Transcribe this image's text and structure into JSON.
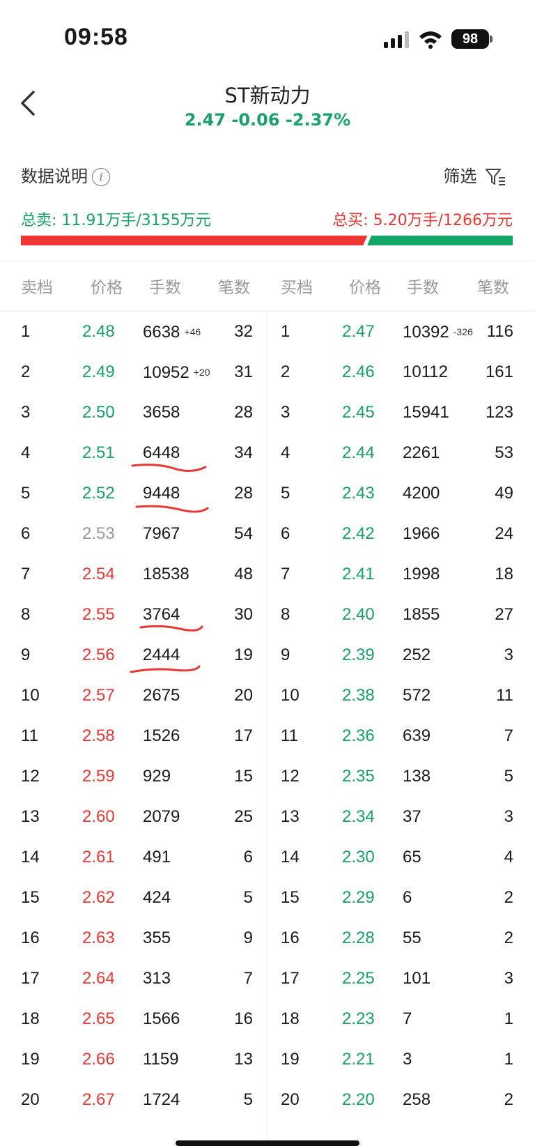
{
  "status": {
    "time": "09:58",
    "battery": "98"
  },
  "header": {
    "title": "ST新动力",
    "quote": "2.47 -0.06 -2.37%"
  },
  "info": {
    "data_explain": "数据说明",
    "info_glyph": "i",
    "filter": "筛选"
  },
  "totals": {
    "sell": "总卖: 11.91万手/3155万元",
    "buy": "总买: 5.20万手/1266万元",
    "sell_fraction": 0.7
  },
  "columns": {
    "sell_level": "卖档",
    "price": "价格",
    "lots": "手数",
    "count": "笔数",
    "buy_level": "买档"
  },
  "colors": {
    "green": "#1aa06a",
    "red": "#e53935",
    "grey": "#999999",
    "annotation": "#e53935"
  },
  "sell": [
    {
      "level": "1",
      "price": "2.48",
      "lots": "6638",
      "delta": "+46",
      "count": "32",
      "color": "green"
    },
    {
      "level": "2",
      "price": "2.49",
      "lots": "10952",
      "delta": "+20",
      "count": "31",
      "color": "green"
    },
    {
      "level": "3",
      "price": "2.50",
      "lots": "3658",
      "delta": "",
      "count": "28",
      "color": "green"
    },
    {
      "level": "4",
      "price": "2.51",
      "lots": "6448",
      "delta": "",
      "count": "34",
      "color": "green"
    },
    {
      "level": "5",
      "price": "2.52",
      "lots": "9448",
      "delta": "",
      "count": "28",
      "color": "green"
    },
    {
      "level": "6",
      "price": "2.53",
      "lots": "7967",
      "delta": "",
      "count": "54",
      "color": "grey"
    },
    {
      "level": "7",
      "price": "2.54",
      "lots": "18538",
      "delta": "",
      "count": "48",
      "color": "red"
    },
    {
      "level": "8",
      "price": "2.55",
      "lots": "3764",
      "delta": "",
      "count": "30",
      "color": "red"
    },
    {
      "level": "9",
      "price": "2.56",
      "lots": "2444",
      "delta": "",
      "count": "19",
      "color": "red"
    },
    {
      "level": "10",
      "price": "2.57",
      "lots": "2675",
      "delta": "",
      "count": "20",
      "color": "red"
    },
    {
      "level": "11",
      "price": "2.58",
      "lots": "1526",
      "delta": "",
      "count": "17",
      "color": "red"
    },
    {
      "level": "12",
      "price": "2.59",
      "lots": "929",
      "delta": "",
      "count": "15",
      "color": "red"
    },
    {
      "level": "13",
      "price": "2.60",
      "lots": "2079",
      "delta": "",
      "count": "25",
      "color": "red"
    },
    {
      "level": "14",
      "price": "2.61",
      "lots": "491",
      "delta": "",
      "count": "6",
      "color": "red"
    },
    {
      "level": "15",
      "price": "2.62",
      "lots": "424",
      "delta": "",
      "count": "5",
      "color": "red"
    },
    {
      "level": "16",
      "price": "2.63",
      "lots": "355",
      "delta": "",
      "count": "9",
      "color": "red"
    },
    {
      "level": "17",
      "price": "2.64",
      "lots": "313",
      "delta": "",
      "count": "7",
      "color": "red"
    },
    {
      "level": "18",
      "price": "2.65",
      "lots": "1566",
      "delta": "",
      "count": "16",
      "color": "red"
    },
    {
      "level": "19",
      "price": "2.66",
      "lots": "1159",
      "delta": "",
      "count": "13",
      "color": "red"
    },
    {
      "level": "20",
      "price": "2.67",
      "lots": "1724",
      "delta": "",
      "count": "5",
      "color": "red"
    }
  ],
  "buy": [
    {
      "level": "1",
      "price": "2.47",
      "lots": "10392",
      "delta": "-326",
      "count": "116"
    },
    {
      "level": "2",
      "price": "2.46",
      "lots": "10112",
      "delta": "",
      "count": "161"
    },
    {
      "level": "3",
      "price": "2.45",
      "lots": "15941",
      "delta": "",
      "count": "123"
    },
    {
      "level": "4",
      "price": "2.44",
      "lots": "2261",
      "delta": "",
      "count": "53"
    },
    {
      "level": "5",
      "price": "2.43",
      "lots": "4200",
      "delta": "",
      "count": "49"
    },
    {
      "level": "6",
      "price": "2.42",
      "lots": "1966",
      "delta": "",
      "count": "24"
    },
    {
      "level": "7",
      "price": "2.41",
      "lots": "1998",
      "delta": "",
      "count": "18"
    },
    {
      "level": "8",
      "price": "2.40",
      "lots": "1855",
      "delta": "",
      "count": "27"
    },
    {
      "level": "9",
      "price": "2.39",
      "lots": "252",
      "delta": "",
      "count": "3"
    },
    {
      "level": "10",
      "price": "2.38",
      "lots": "572",
      "delta": "",
      "count": "11"
    },
    {
      "level": "11",
      "price": "2.36",
      "lots": "639",
      "delta": "",
      "count": "7"
    },
    {
      "level": "12",
      "price": "2.35",
      "lots": "138",
      "delta": "",
      "count": "5"
    },
    {
      "level": "13",
      "price": "2.34",
      "lots": "37",
      "delta": "",
      "count": "3"
    },
    {
      "level": "14",
      "price": "2.30",
      "lots": "65",
      "delta": "",
      "count": "4"
    },
    {
      "level": "15",
      "price": "2.29",
      "lots": "6",
      "delta": "",
      "count": "2"
    },
    {
      "level": "16",
      "price": "2.28",
      "lots": "55",
      "delta": "",
      "count": "2"
    },
    {
      "level": "17",
      "price": "2.25",
      "lots": "101",
      "delta": "",
      "count": "3"
    },
    {
      "level": "18",
      "price": "2.23",
      "lots": "7",
      "delta": "",
      "count": "1"
    },
    {
      "level": "19",
      "price": "2.21",
      "lots": "3",
      "delta": "",
      "count": "1"
    },
    {
      "level": "20",
      "price": "2.20",
      "lots": "258",
      "delta": "",
      "count": "2"
    }
  ]
}
